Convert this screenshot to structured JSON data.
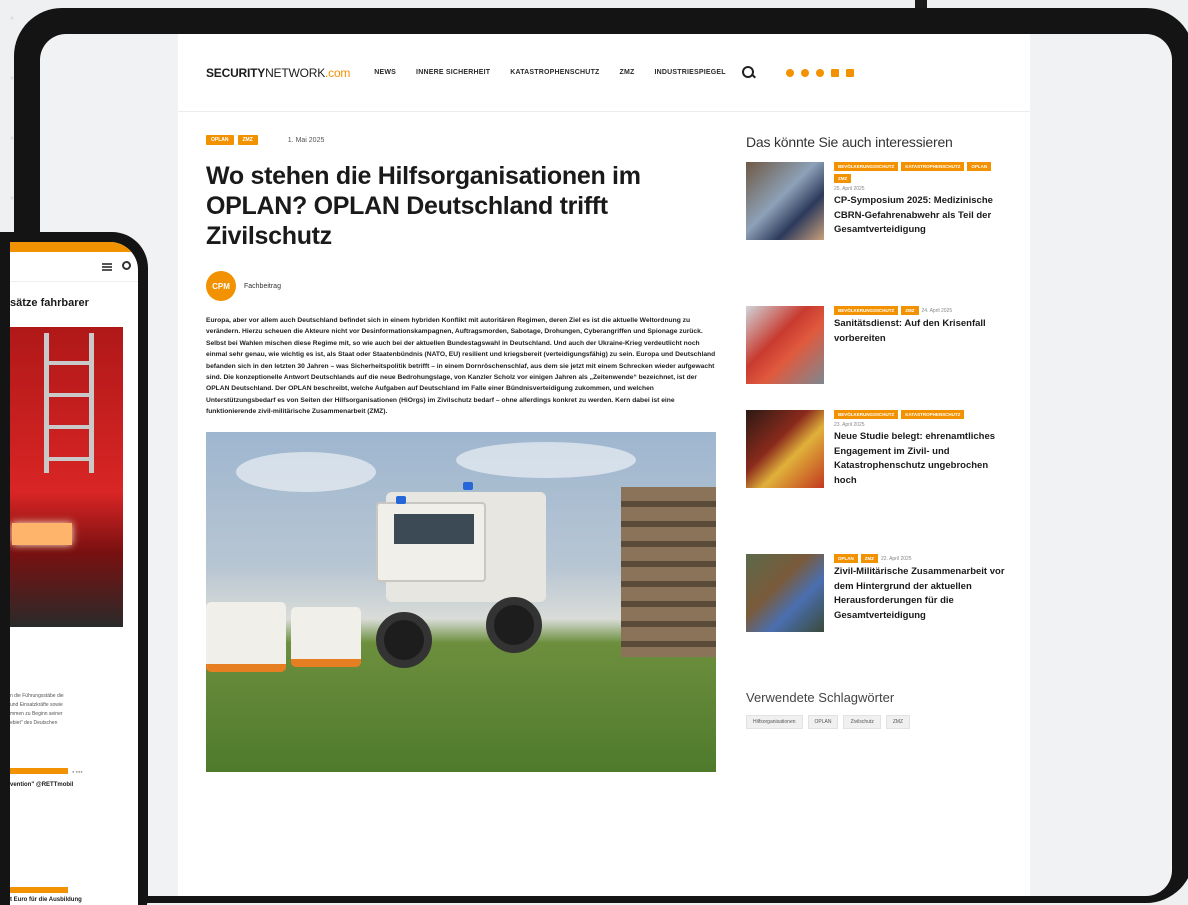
{
  "logo": {
    "part1": "SECURITY",
    "part2": "NETWORK",
    "part3": ".com"
  },
  "nav": [
    "NEWS",
    "INNERE SICHERHEIT",
    "KATASTROPHENSCHUTZ",
    "ZMZ",
    "INDUSTRIESPIEGEL"
  ],
  "icons": {
    "search": "search-icon",
    "socials": [
      "whatsapp-icon",
      "facebook-icon",
      "instagram-icon",
      "linkedin-icon",
      "rss-icon"
    ]
  },
  "colors": {
    "accent": "#f39200",
    "dark": "#141414"
  },
  "article": {
    "tags": [
      "OPLAN",
      "ZMZ"
    ],
    "date": "1. Mai 2025",
    "title": "Wo stehen die Hilfsorganisationen im OPLAN? OPLAN Deutschland trifft Zivilschutz",
    "author_avatar": "CPM",
    "author": "Fachbeitrag",
    "body": "Europa, aber vor allem auch Deutschland befindet sich in einem hybriden Konflikt mit autoritären Regimen, deren Ziel es ist die aktuelle Weltordnung zu verändern. Hierzu scheuen die Akteure nicht vor Desinformationskampagnen, Auftragsmorden, Sabotage, Drohungen, Cyberangriffen und Spionage zurück. Selbst bei Wahlen mischen diese Regime mit, so wie auch bei der aktuellen Bundestagswahl in Deutschland. Und auch der Ukraine-Krieg verdeutlicht noch einmal sehr genau, wie wichtig es ist, als Staat oder Staatenbündnis (NATO, EU) resilient und kriegsbereit (verteidigungsfähig) zu sein. Europa und Deutschland befanden sich in den letzten 30 Jahren – was Sicherheitspolitik betrifft – in einem Dornröschenschlaf, aus dem sie jetzt mit einem Schrecken wieder aufgewacht sind. Die konzeptionelle Antwort Deutschlands auf die neue Bedrohungslage, von Kanzler Scholz vor einigen Jahren als „Zeitenwende“ bezeichnet, ist der OPLAN Deutschland. Der OPLAN beschreibt, welche Aufgaben auf Deutschland im Falle einer Bündnisverteidigung zukommen, und welchen Unterstützungsbedarf es von Seiten der Hilfsorganisationen (HiOrgs) im Zivilschutz bedarf – ohne allerdings konkret zu werden. Kern dabei ist eine funktionierende zivil-militärische Zusammenarbeit (ZMZ)."
  },
  "sidebar": {
    "heading": "Das könnte Sie auch interessieren",
    "items": [
      {
        "tags": [
          "BEVÖLKERUNGSSCHUTZ",
          "KATASTROPHENSCHUTZ",
          "OPLAN",
          "ZMZ"
        ],
        "date": "25. April 2025",
        "title": "CP-Symposium 2025: Medizinische CBRN-Gefahrenabwehr als Teil der Gesamtverteidigung"
      },
      {
        "tags": [
          "BEVÖLKERUNGSSCHUTZ",
          "ZMZ"
        ],
        "date": "24. April 2025",
        "title": "Sanitätsdienst: Auf den Krisenfall vorbereiten"
      },
      {
        "tags": [
          "BEVÖLKERUNGSSCHUTZ",
          "KATASTROPHENSCHUTZ"
        ],
        "date": "23. April 2025",
        "title": "Neue Studie belegt: ehrenamtliches Engagement im Zivil- und Katastrophenschutz ungebrochen hoch"
      },
      {
        "tags": [
          "OPLAN",
          "ZMZ"
        ],
        "date": "22. April 2025",
        "title": "Zivil-Militärische Zusammenarbeit vor dem Hintergrund der aktuellen Herausforderungen für die Gesamtverteidigung"
      }
    ],
    "keywords_heading": "Verwendete Schlagwörter",
    "keywords": [
      "Hilfsorganisationen",
      "OPLAN",
      "Zivilschutz",
      "ZMZ"
    ]
  },
  "phone": {
    "title": "sätze fahrbarer",
    "text": [
      "n die Führungsstäbe die",
      "und Einsatzkräfte sowie",
      "mmen zu Beginn seiner",
      "ebiet\" des Deutschen"
    ],
    "link1": "vention\" @RETTmobil",
    "link2": "t Euro für die Ausbildung"
  }
}
